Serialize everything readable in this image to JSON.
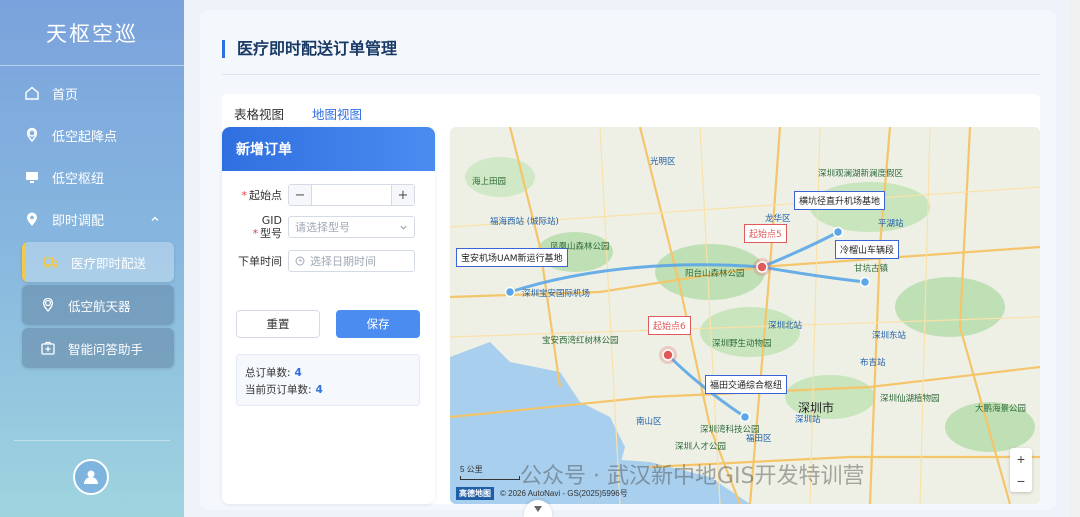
{
  "app": {
    "brand": "天枢空巡"
  },
  "sidebar": {
    "items": [
      {
        "label": "首页",
        "icon": "home-icon"
      },
      {
        "label": "低空起降点",
        "icon": "location-pin-icon"
      },
      {
        "label": "低空枢纽",
        "icon": "monitor-icon"
      },
      {
        "label": "即时调配",
        "icon": "map-marker-icon",
        "expanded": true
      }
    ],
    "sub_items": [
      {
        "label": "医疗即时配送",
        "icon": "truck-icon",
        "active": true
      },
      {
        "label": "低空航天器",
        "icon": "drone-pin-icon"
      },
      {
        "label": "智能问答助手",
        "icon": "medical-kit-icon"
      }
    ]
  },
  "page": {
    "title": "医疗即时配送订单管理"
  },
  "tabs": [
    {
      "label": "表格视图",
      "active": false
    },
    {
      "label": "地图视图",
      "active": true
    }
  ],
  "form": {
    "title": "新增订单",
    "start_label": "起始点",
    "start_minus": "−",
    "start_plus": "+",
    "model_label_1": "GID",
    "model_label_2": "型号",
    "model_placeholder": "请选择型号",
    "time_label": "下单时间",
    "time_placeholder": "选择日期时间",
    "reset_label": "重置",
    "save_label": "保存",
    "total_label": "总订单数:",
    "total_value": "4",
    "page_label": "当前页订单数:",
    "page_value": "4"
  },
  "map": {
    "labels": {
      "bao_an": "宝安机场UAM新运行基地",
      "heng_keng": "横坑径直升机场基地",
      "qi_shi_5": "起始点5",
      "leng_shan": "冷榴山车辆段",
      "qi_shi_6": "起始点6",
      "futian": "福田交通综合枢纽"
    },
    "places": {
      "p1": "海上田园",
      "p2": "福海西站 (城际站)",
      "p3": "凤凰山森林公园",
      "p4": "深圳宝安国际机场",
      "p5": "阳台山森林公园",
      "p6": "宝安西湾红树林公园",
      "p7": "深圳北站",
      "p8": "深圳野生动物园",
      "p9": "深圳观澜湖新澜度假区",
      "p10": "平湖站",
      "p11": "甘坑古镇",
      "p12": "深圳东站",
      "p13": "深圳人才公园",
      "p14": "深圳站",
      "p15": "深圳仙湖植物园",
      "p16": "大鹏海景公园",
      "p17": "光明区",
      "p18": "龙华区",
      "p19": "南山区",
      "p20": "福田区",
      "p21": "布吉站",
      "p22": "深圳湾科技公园"
    },
    "city": "深圳市",
    "scale": "5 公里",
    "logo": "高德地图",
    "copyright": "© 2026 AutoNavi - GS(2025)5996号",
    "zoom_in": "+",
    "zoom_out": "−",
    "watermark": "公众号 · 武汉新中地GIS开发特训营"
  },
  "colors": {
    "accent": "#2f6fe0",
    "route": "#4ea2e6",
    "start_red": "#e05a5a"
  }
}
